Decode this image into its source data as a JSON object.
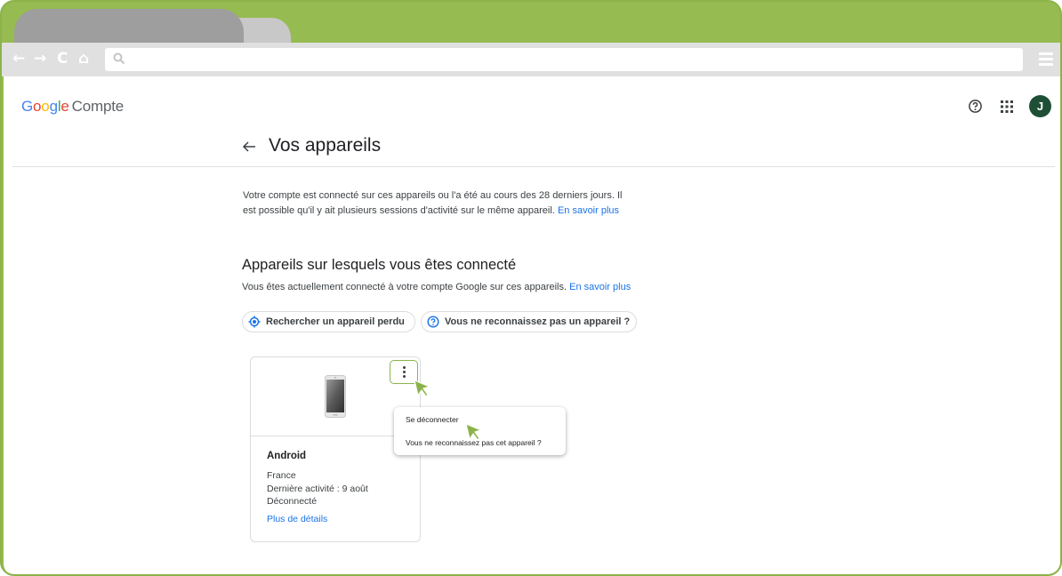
{
  "browser": {
    "nav": {
      "back": "←",
      "forward": "→",
      "reload": "C",
      "home": "⌂"
    },
    "address": {
      "value": "",
      "icon": "search-icon"
    }
  },
  "header": {
    "logo": {
      "g1": "G",
      "g2": "o",
      "g3": "o",
      "g4": "g",
      "g5": "l",
      "g6": "e",
      "product": "Compte"
    },
    "help_icon": "help-circle-icon",
    "apps_icon": "apps-grid-icon",
    "avatar_letter": "J"
  },
  "title": {
    "back_icon": "arrow-back-icon",
    "text": "Vos appareils"
  },
  "intro": {
    "text": "Votre compte est connecté sur ces appareils ou l'a été au cours des 28 derniers jours. Il est possible qu'il y ait plusieurs sessions d'activité sur le même appareil.",
    "link": "En savoir plus"
  },
  "section": {
    "title": "Appareils sur lesquels vous êtes connecté",
    "desc": "Vous êtes actuellement connecté à votre compte Google sur ces appareils.",
    "link": "En savoir plus"
  },
  "chips": [
    {
      "label": "Rechercher un appareil perdu",
      "icon": "locate-icon"
    },
    {
      "label": "Vous ne reconnaissez pas un appareil ?",
      "icon": "help-circle-icon"
    }
  ],
  "device": {
    "name": "Android",
    "location": "France",
    "last_activity": "Dernière activité : 9 août",
    "status": "Déconnecté",
    "details_link": "Plus de détails",
    "icon": "smartphone-icon"
  },
  "menu": {
    "items": [
      "Se déconnecter",
      "Vous ne reconnaissez pas cet appareil ?"
    ]
  },
  "colors": {
    "frame": "#96bb51",
    "accent": "#1a73e8",
    "avatar": "#1e4f36",
    "highlight": "#8bb34a"
  }
}
